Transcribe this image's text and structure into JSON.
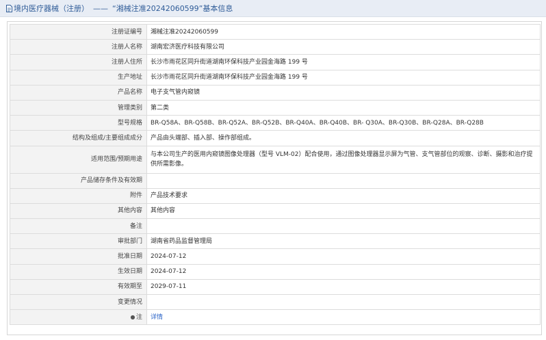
{
  "header": {
    "category": "境内医疗器械（注册）",
    "separator": "——",
    "title": "“湘械注准20242060599”基本信息"
  },
  "rows": [
    {
      "label": "注册证编号",
      "value": "湘械注准20242060599"
    },
    {
      "label": "注册人名称",
      "value": "湖南宏济医疗科技有限公司"
    },
    {
      "label": "注册人住所",
      "value": "长沙市雨花区同升街道湖南环保科技产业园金海路 199 号"
    },
    {
      "label": "生产地址",
      "value": "长沙市雨花区同升街道湖南环保科技产业园金海路 199 号"
    },
    {
      "label": "产品名称",
      "value": "电子支气管内窥镜"
    },
    {
      "label": "管理类别",
      "value": "第二类"
    },
    {
      "label": "型号规格",
      "value": "BR-Q58A、BR-Q58B、BR-Q52A、BR-Q52B、BR-Q40A、BR-Q40B、BR- Q30A、BR-Q30B、BR-Q28A、BR-Q28B"
    },
    {
      "label": "结构及组成/主要组成成分",
      "value": "产品由头端部、插入部、操作部组成。"
    },
    {
      "label": "适用范围/预期用途",
      "value": "与本公司生产的医用内窥镜图像处理器（型号 VLM-02）配合使用，通过图像处理器显示屏为气管、支气管部位的观察、诊断、摄影和治疗提供所需影像。"
    },
    {
      "label": "产品储存条件及有效期",
      "value": ""
    },
    {
      "label": "附件",
      "value": "产品技术要求"
    },
    {
      "label": "其他内容",
      "value": "其他内容"
    },
    {
      "label": "备注",
      "value": ""
    },
    {
      "label": "审批部门",
      "value": "湖南省药品监督管理局"
    },
    {
      "label": "批准日期",
      "value": "2024-07-12"
    },
    {
      "label": "生效日期",
      "value": "2024-07-12"
    },
    {
      "label": "有效期至",
      "value": "2029-07-11"
    },
    {
      "label": "变更情况",
      "value": ""
    }
  ],
  "note_row": {
    "label": "注",
    "link": "详情",
    "icon": "info-icon"
  },
  "colors": {
    "header_bg": "#e8edf5",
    "header_text": "#2f5c98",
    "label_bg": "#f3f3f3",
    "link": "#2a63c7"
  }
}
